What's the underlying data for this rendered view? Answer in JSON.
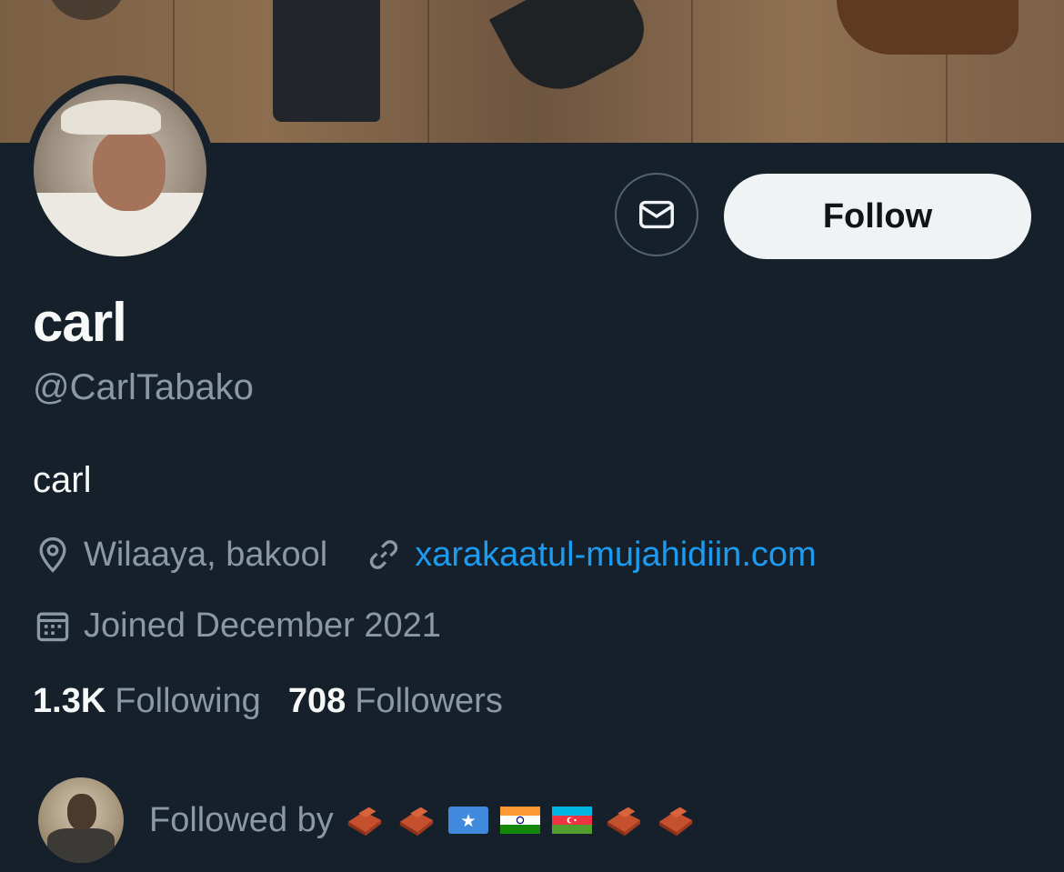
{
  "profile": {
    "display_name": "carl",
    "handle": "@CarlTabako",
    "bio": "carl",
    "location": "Wilaaya, bakool",
    "website": "xarakaatul-mujahidiin.com",
    "joined": "Joined December 2021"
  },
  "actions": {
    "follow_label": "Follow",
    "message_icon": "envelope-icon"
  },
  "stats": {
    "following_count": "1.3K",
    "following_label": "Following",
    "followers_count": "708",
    "followers_label": "Followers"
  },
  "followed_by": {
    "label": "Followed by",
    "badges": [
      "brick-emoji",
      "brick-emoji",
      "somalia-flag",
      "india-flag",
      "azerbaijan-flag",
      "brick-emoji",
      "brick-emoji"
    ]
  },
  "colors": {
    "background": "#15202b",
    "primary_text": "#f7f9f9",
    "secondary_text": "#8b98a5",
    "link": "#1d9bf0",
    "follow_button_bg": "#eff3f4"
  }
}
